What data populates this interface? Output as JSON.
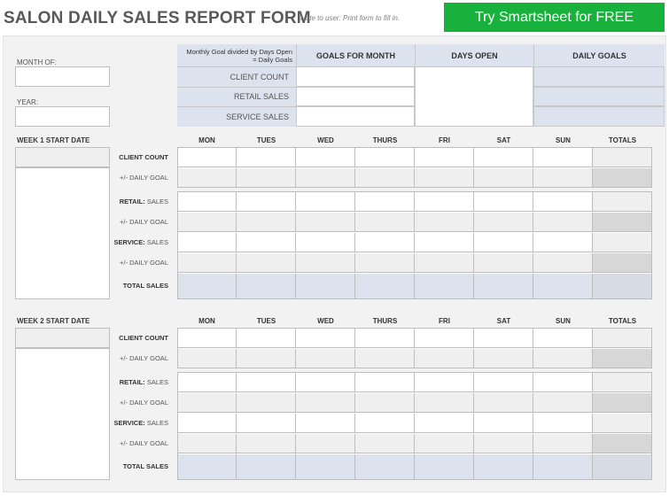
{
  "header": {
    "title": "SALON DAILY SALES REPORT FORM",
    "note": "Note to user: Print form to fill in.",
    "cta_label": "Try Smartsheet for FREE"
  },
  "form": {
    "month_label": "MONTH OF:",
    "year_label": "YEAR:"
  },
  "goals_table": {
    "corner_note": "Monthly Goal divided by Days Open = Daily Goals",
    "columns": [
      "GOALS FOR MONTH",
      "DAYS OPEN",
      "DAILY GOALS"
    ],
    "rows": [
      "CLIENT COUNT",
      "RETAIL SALES",
      "SERVICE SALES"
    ]
  },
  "days": [
    "MON",
    "TUES",
    "WED",
    "THURS",
    "FRI",
    "SAT",
    "SUN",
    "TOTALS"
  ],
  "weeks": [
    {
      "start_label": "WEEK 1 START DATE",
      "rows": [
        {
          "bold": "CLIENT COUNT",
          "rest": ""
        },
        {
          "bold": "",
          "rest": "+/- DAILY GOAL"
        },
        {
          "bold": "RETAIL:",
          "rest": " SALES"
        },
        {
          "bold": "",
          "rest": "+/- DAILY GOAL"
        },
        {
          "bold": "SERVICE:",
          "rest": " SALES"
        },
        {
          "bold": "",
          "rest": "+/- DAILY GOAL"
        },
        {
          "bold": "TOTAL SALES",
          "rest": ""
        }
      ]
    },
    {
      "start_label": "WEEK 2 START DATE",
      "rows": [
        {
          "bold": "CLIENT COUNT",
          "rest": ""
        },
        {
          "bold": "",
          "rest": "+/- DAILY GOAL"
        },
        {
          "bold": "RETAIL:",
          "rest": " SALES"
        },
        {
          "bold": "",
          "rest": "+/- DAILY GOAL"
        },
        {
          "bold": "SERVICE:",
          "rest": " SALES"
        },
        {
          "bold": "",
          "rest": "+/- DAILY GOAL"
        },
        {
          "bold": "TOTAL SALES",
          "rest": ""
        }
      ]
    }
  ],
  "colors": {
    "header_blue": "#dde3ee",
    "cta_green": "#17b13c",
    "row_gray": "#efefef",
    "totals_gray": "#d7d7d7"
  }
}
